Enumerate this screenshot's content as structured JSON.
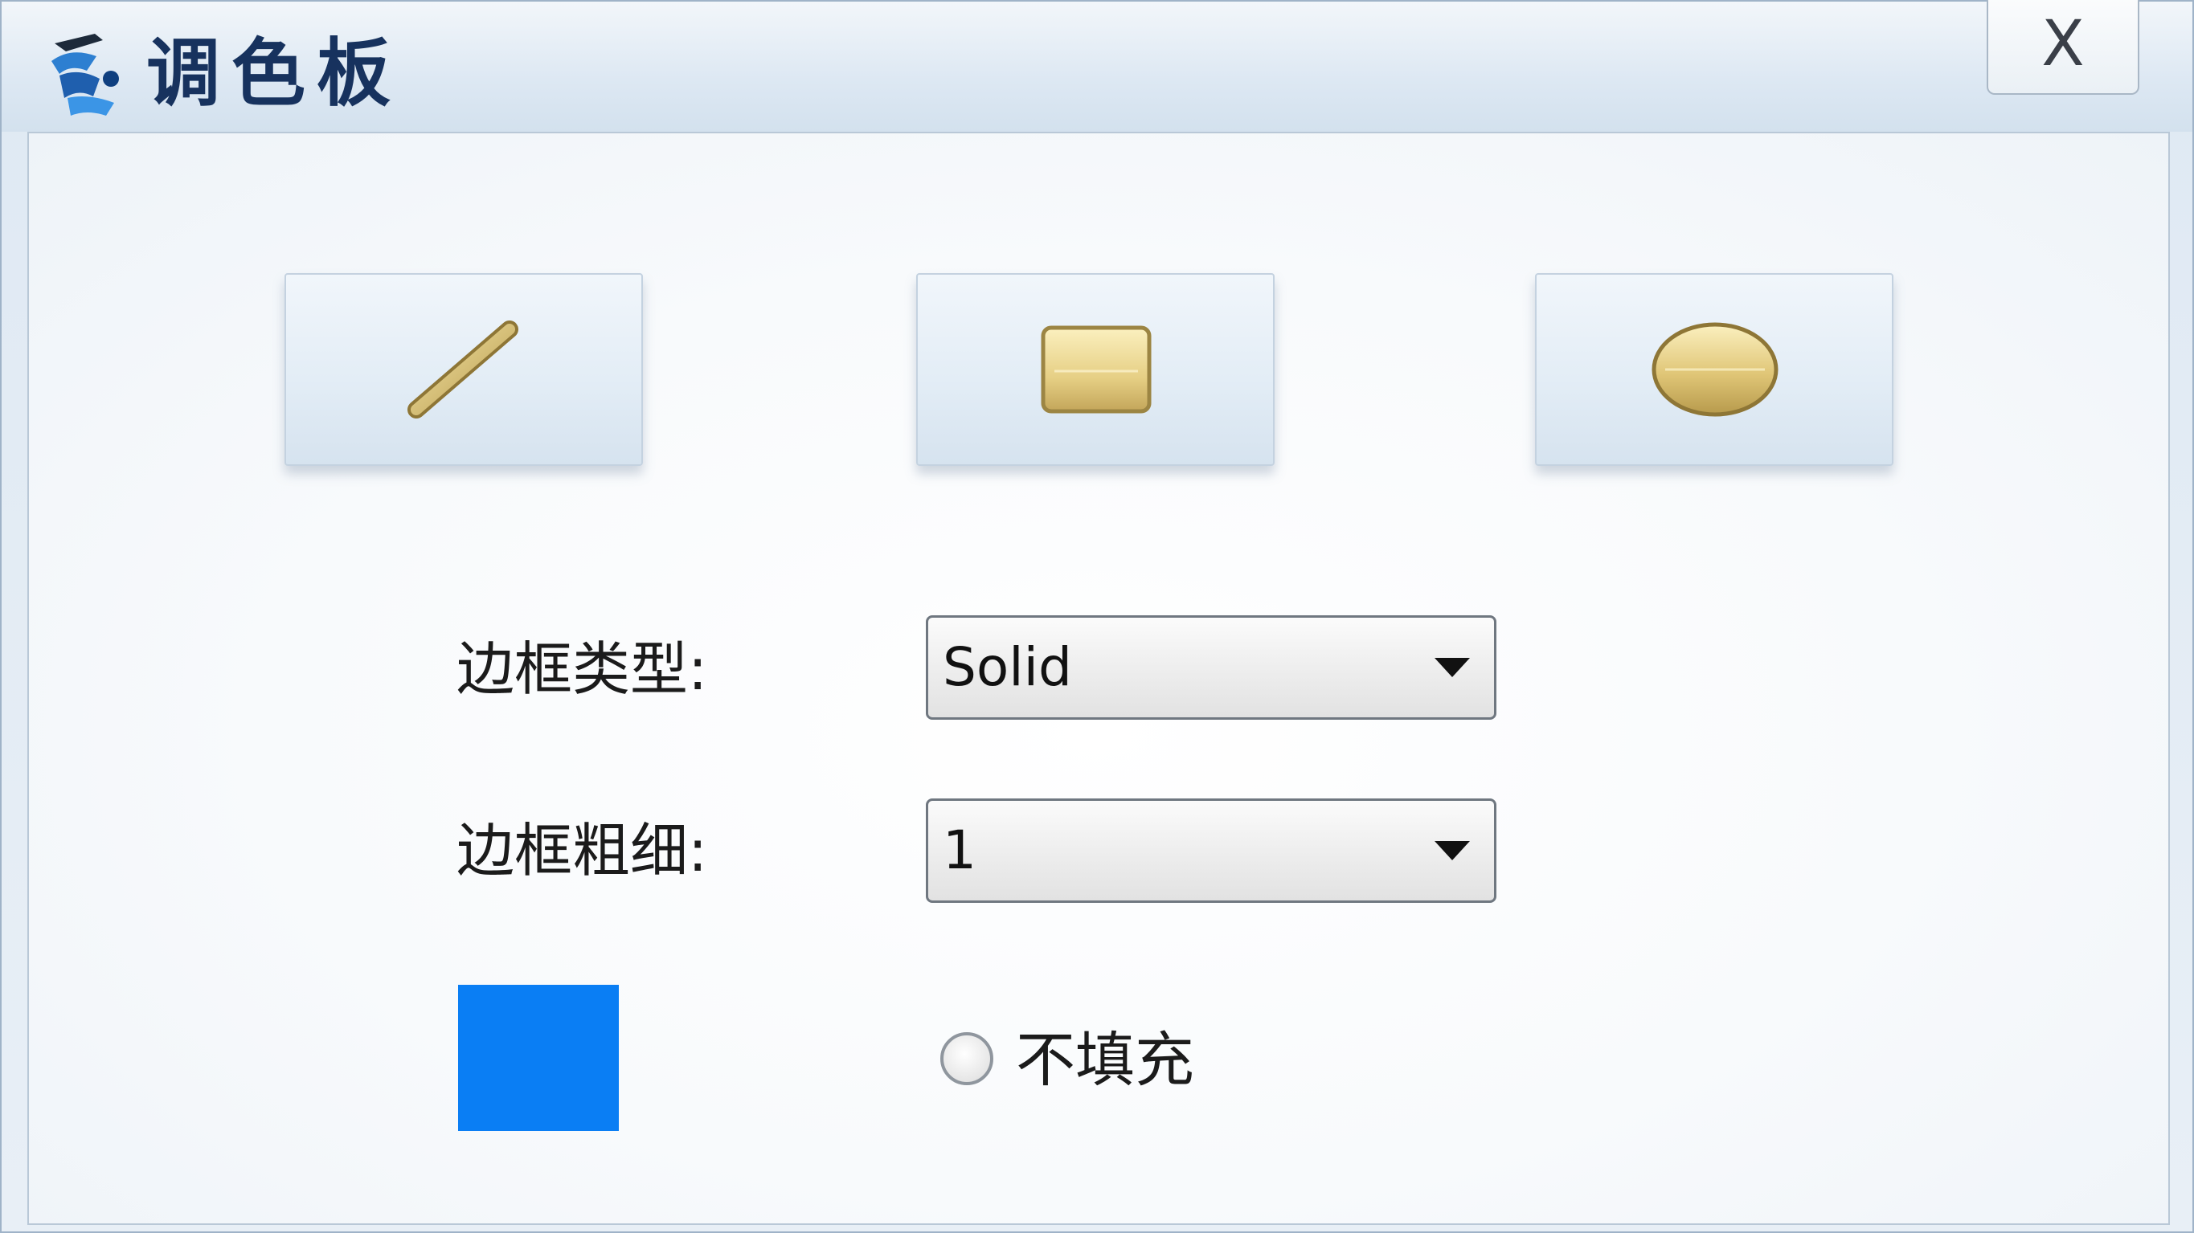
{
  "window": {
    "title": "调色板",
    "close_label": "X"
  },
  "tools": [
    {
      "name": "line",
      "icon": "line-icon"
    },
    {
      "name": "rectangle",
      "icon": "rectangle-icon"
    },
    {
      "name": "ellipse",
      "icon": "ellipse-icon"
    }
  ],
  "border_type": {
    "label": "边框类型:",
    "value": "Solid"
  },
  "border_width": {
    "label": "边框粗细:",
    "value": "1"
  },
  "fill": {
    "color": "#0a7ef4",
    "no_fill_label": "不填充",
    "no_fill_checked": false
  },
  "colors": {
    "title_text": "#17325e",
    "swatch": "#0a7ef4",
    "icon_gold": "#d9c27a"
  }
}
